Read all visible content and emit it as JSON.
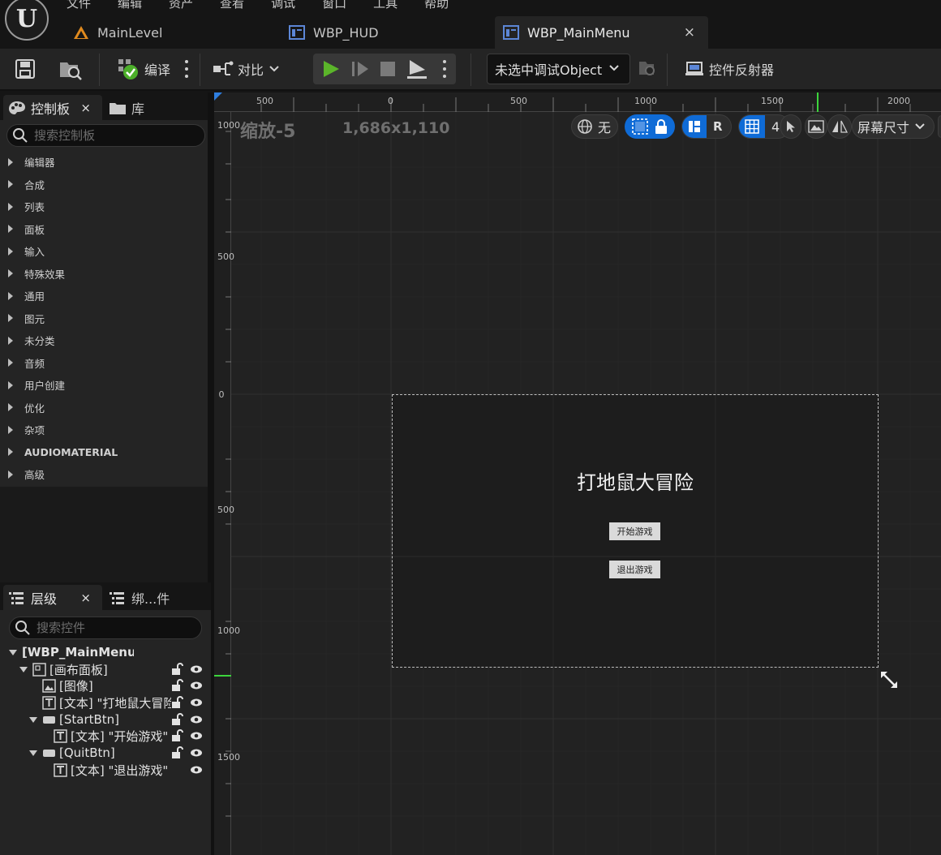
{
  "menu": [
    "文件",
    "编辑",
    "资产",
    "查看",
    "调试",
    "窗口",
    "工具",
    "帮助"
  ],
  "tabs": {
    "main_level": "MainLevel",
    "hud": "WBP_HUD",
    "main_menu": "WBP_MainMenu",
    "close": "×"
  },
  "toolbar": {
    "compile": "编译",
    "diff": "对比",
    "debug_object": "未选中调试Object",
    "widget_reflector": "控件反射器"
  },
  "palette": {
    "tab_label": "控制板",
    "library_label": "库",
    "search_placeholder": "搜索控制板",
    "categories": [
      "编辑器",
      "合成",
      "列表",
      "面板",
      "输入",
      "特殊效果",
      "通用",
      "图元",
      "未分类",
      "音频",
      "用户创建",
      "优化",
      "杂项",
      "AUDIOMATERIAL",
      "高级"
    ]
  },
  "hierarchy": {
    "tab_label": "层级",
    "bind_label": "绑...件",
    "search_placeholder": "搜索控件",
    "items": [
      {
        "label": "[WBP_MainMenu]"
      },
      {
        "label": "[画布面板]"
      },
      {
        "label": "[图像]"
      },
      {
        "label": "[文本] \"打地鼠大冒险\""
      },
      {
        "label": "[StartBtn]"
      },
      {
        "label": "[文本] \"开始游戏\""
      },
      {
        "label": "[QuitBtn]"
      },
      {
        "label": "[文本] \"退出游戏\""
      }
    ]
  },
  "viewport": {
    "zoom": "缩放-5",
    "resolution": "1,686x1,110",
    "world_label": "无",
    "grid_count": "4",
    "r_label": "R",
    "screen_size": "屏幕尺寸",
    "ruler_top": [
      "500",
      "0",
      "500",
      "1000",
      "1500",
      "2000"
    ],
    "ruler_left": [
      "1000",
      "500",
      "0",
      "500",
      "1000",
      "1500"
    ]
  },
  "design": {
    "title": "打地鼠大冒险",
    "start_button": "开始游戏",
    "quit_button": "退出游戏"
  },
  "colors": {
    "accent_blue": "#0f6bd6",
    "play_green": "#5bb52a"
  }
}
